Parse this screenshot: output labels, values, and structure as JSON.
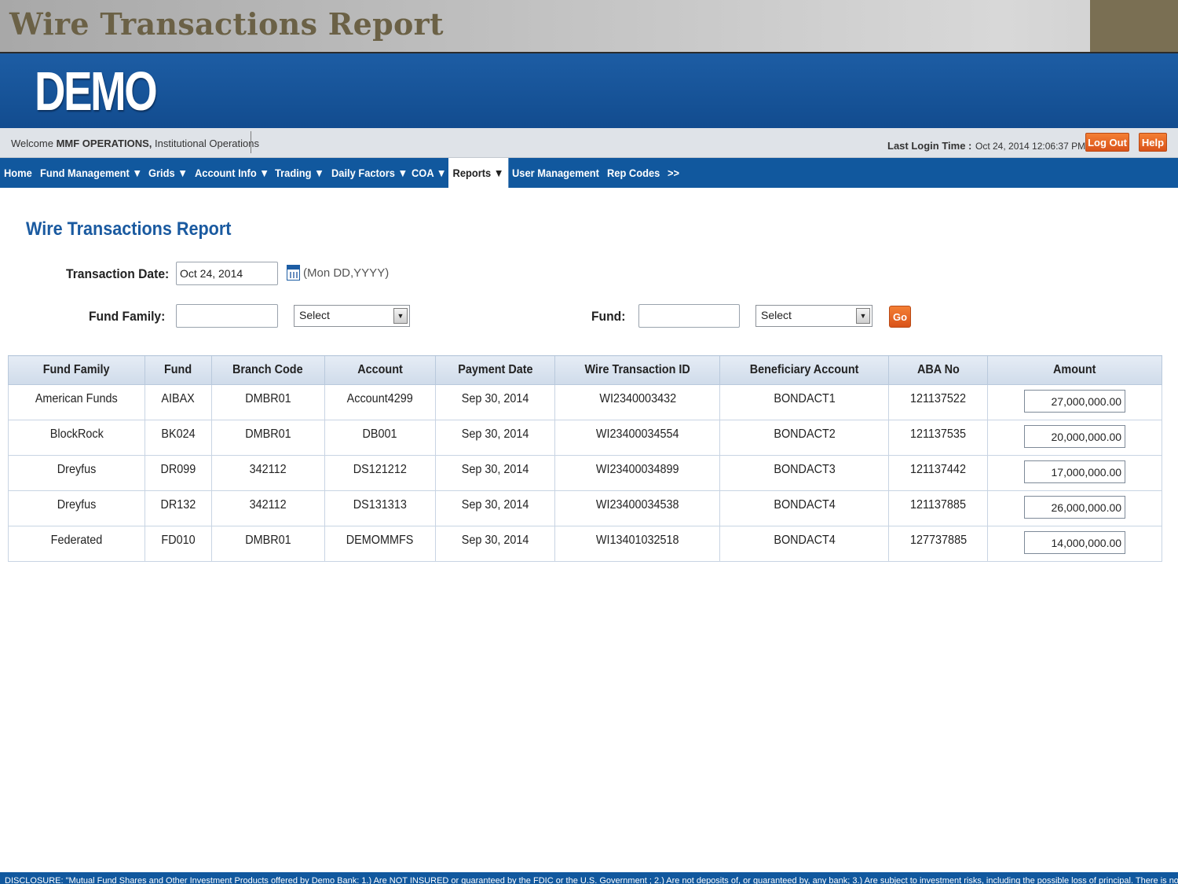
{
  "slide": {
    "title": "Wire Transactions Report"
  },
  "brand": {
    "logo": "DEMO"
  },
  "welcome": {
    "prefix": "Welcome",
    "user": "MMF OPERATIONS,",
    "role": "Institutional Operations",
    "last_login_label": "Last Login Time :",
    "last_login_value": "Oct 24, 2014 12:06:37 PM",
    "logout_label": "Log Out",
    "help_label": "Help"
  },
  "nav": {
    "items": [
      {
        "label": "Home"
      },
      {
        "label": "Fund Management ▼"
      },
      {
        "label": "Grids ▼"
      },
      {
        "label": "Account Info ▼"
      },
      {
        "label": "Trading ▼"
      },
      {
        "label": "Daily Factors ▼"
      },
      {
        "label": "COA ▼"
      },
      {
        "label": "Reports ▼"
      },
      {
        "label": "User Management"
      },
      {
        "label": "Rep Codes"
      },
      {
        "label": ">>"
      }
    ],
    "active_index": 7
  },
  "page": {
    "heading": "Wire Transactions Report"
  },
  "form": {
    "transaction_date_label": "Transaction Date:",
    "transaction_date_value": "Oct 24, 2014",
    "date_format_hint": "(Mon DD,YYYY)",
    "fund_family_label": "Fund Family:",
    "fund_family_value": "",
    "fund_family_select": "Select",
    "fund_label": "Fund:",
    "fund_value": "",
    "fund_select": "Select",
    "go_label": "Go"
  },
  "table": {
    "columns": [
      "Fund Family",
      "Fund",
      "Branch Code",
      "Account",
      "Payment Date",
      "Wire Transaction ID",
      "Beneficiary Account",
      "ABA No",
      "Amount"
    ],
    "rows": [
      {
        "fund_family": "American Funds",
        "fund": "AIBAX",
        "branch_code": "DMBR01",
        "account": "Account4299",
        "payment_date": "Sep 30, 2014",
        "wire_id": "WI2340003432",
        "beneficiary": "BONDACT1",
        "aba": "121137522",
        "amount": "27,000,000.00"
      },
      {
        "fund_family": "BlockRock",
        "fund": "BK024",
        "branch_code": "DMBR01",
        "account": "DB001",
        "payment_date": "Sep 30, 2014",
        "wire_id": "WI23400034554",
        "beneficiary": "BONDACT2",
        "aba": "121137535",
        "amount": "20,000,000.00"
      },
      {
        "fund_family": "Dreyfus",
        "fund": "DR099",
        "branch_code": "342112",
        "account": "DS121212",
        "payment_date": "Sep 30, 2014",
        "wire_id": "WI23400034899",
        "beneficiary": "BONDACT3",
        "aba": "121137442",
        "amount": "17,000,000.00"
      },
      {
        "fund_family": "Dreyfus",
        "fund": "DR132",
        "branch_code": "342112",
        "account": "DS131313",
        "payment_date": "Sep 30, 2014",
        "wire_id": "WI23400034538",
        "beneficiary": "BONDACT4",
        "aba": "121137885",
        "amount": "26,000,000.00"
      },
      {
        "fund_family": "Federated",
        "fund": "FD010",
        "branch_code": "DMBR01",
        "account": "DEMOMMFS",
        "payment_date": "Sep 30, 2014",
        "wire_id": "WI13401032518",
        "beneficiary": "BONDACT4",
        "aba": "127737885",
        "amount": "14,000,000.00"
      }
    ]
  },
  "footer": {
    "disclosure": "DISCLOSURE: \"Mutual Fund Shares and Other Investment Products offered by Demo Bank: 1.) Are NOT INSURED or guaranteed by the FDIC or the U.S. Government ; 2.) Are not deposits of, or guaranteed by, any bank; 3.) Are subject to investment risks, including the possible loss of principal. There is no assurance"
  },
  "colors": {
    "brand_blue": "#11589e",
    "accent_orange": "#e8651f",
    "heading_blue": "#1a5aa0",
    "slide_title": "#6b6146"
  },
  "icons": {
    "calendar": "calendar-icon",
    "dropdown": "chevron-down-icon"
  }
}
